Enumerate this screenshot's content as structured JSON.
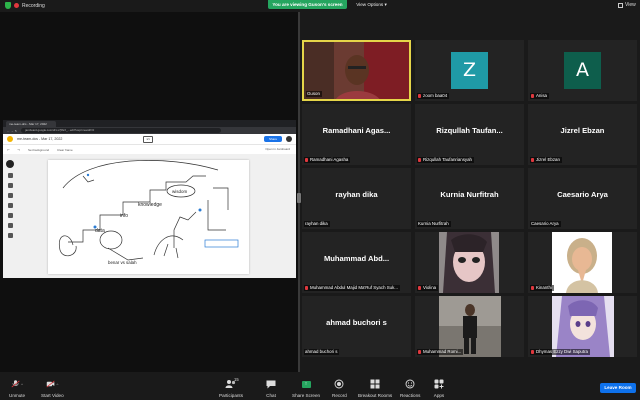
{
  "top": {
    "recording": "Recording",
    "viewing_banner": "You are viewing Guson's screen",
    "view_options": "View Options",
    "view_button": "View"
  },
  "browser": {
    "tab_title": "me-team-dcs - Mar 17, 2022",
    "address": "jamboard.google.com/d/1-x7j8sX_...edit?usp=meet&f=0",
    "jam_title": "me-team-dcs - Mar 17, 2022",
    "share_label": "Share",
    "set_background": "Set background",
    "clear_frame": "Clear frame",
    "open_in_jamboard": "Open in Jamboard",
    "frame_counter": "1/1"
  },
  "board": {
    "labels": [
      {
        "text": "knowledge",
        "id": "knowledge"
      },
      {
        "text": "wisdom",
        "id": "wisdom"
      },
      {
        "text": "info",
        "id": "info"
      },
      {
        "text": "data",
        "id": "data"
      },
      {
        "text": "benar vs salah",
        "id": "benar"
      }
    ]
  },
  "participants": [
    {
      "name": "Guson",
      "type": "video",
      "active": true,
      "muted": false
    },
    {
      "name": "zoom baa04",
      "type": "letter",
      "letter": "Z",
      "color": "#1f9aa6",
      "muted": true
    },
    {
      "name": "Anisa",
      "type": "letter",
      "letter": "A",
      "color": "#0e5e4c",
      "muted": true
    },
    {
      "name": "Ramadhani Agasha",
      "display": "Ramadhani  Agas...",
      "type": "name",
      "muted": true
    },
    {
      "name": "Rizqullah Taufanriansyah",
      "display": "Rizqullah  Taufan...",
      "type": "name",
      "muted": true
    },
    {
      "name": "Jizrel Ebzan",
      "display": "Jizrel Ebzan",
      "type": "name",
      "muted": true
    },
    {
      "name": "rayhan dika",
      "display": "rayhan dika",
      "type": "name",
      "muted": false
    },
    {
      "name": "Kurnia Nurfitrah",
      "display": "Kurnia Nurfitrah",
      "type": "name",
      "muted": false
    },
    {
      "name": "Caesario Arya",
      "display": "Caesario Arya",
      "type": "name",
      "muted": false
    },
    {
      "name": "Muhammad Abdul Majid Ma'Ruf Syach Suk...",
      "display": "Muhammad  Abd...",
      "type": "name",
      "muted": true
    },
    {
      "name": "Violina",
      "type": "photo-anime",
      "muted": true
    },
    {
      "name": "Kinanthi",
      "type": "photo-memoji",
      "muted": true
    },
    {
      "name": "ahmad buchori s",
      "display": "ahmad buchori s",
      "type": "name",
      "muted": false
    },
    {
      "name": "Muhammad Romi...",
      "type": "photo-person",
      "muted": true
    },
    {
      "name": "Dhymas Ezzy Dwi Saputra",
      "type": "photo-anime2",
      "muted": true
    }
  ],
  "toolbar": {
    "unmute": "Unmute",
    "start_video": "Start Video",
    "participants": "Participants",
    "participants_count": "15",
    "chat": "Chat",
    "share_screen": "Share Screen",
    "record": "Record",
    "breakout_rooms": "Breakout Rooms",
    "reactions": "Reactions",
    "apps": "Apps",
    "leave_room": "Leave Room"
  },
  "colors": {
    "viewing_green": "#25a55f",
    "leave_blue": "#0e71eb",
    "active_speaker": "#e5d549",
    "muted_red": "#e0383e"
  }
}
